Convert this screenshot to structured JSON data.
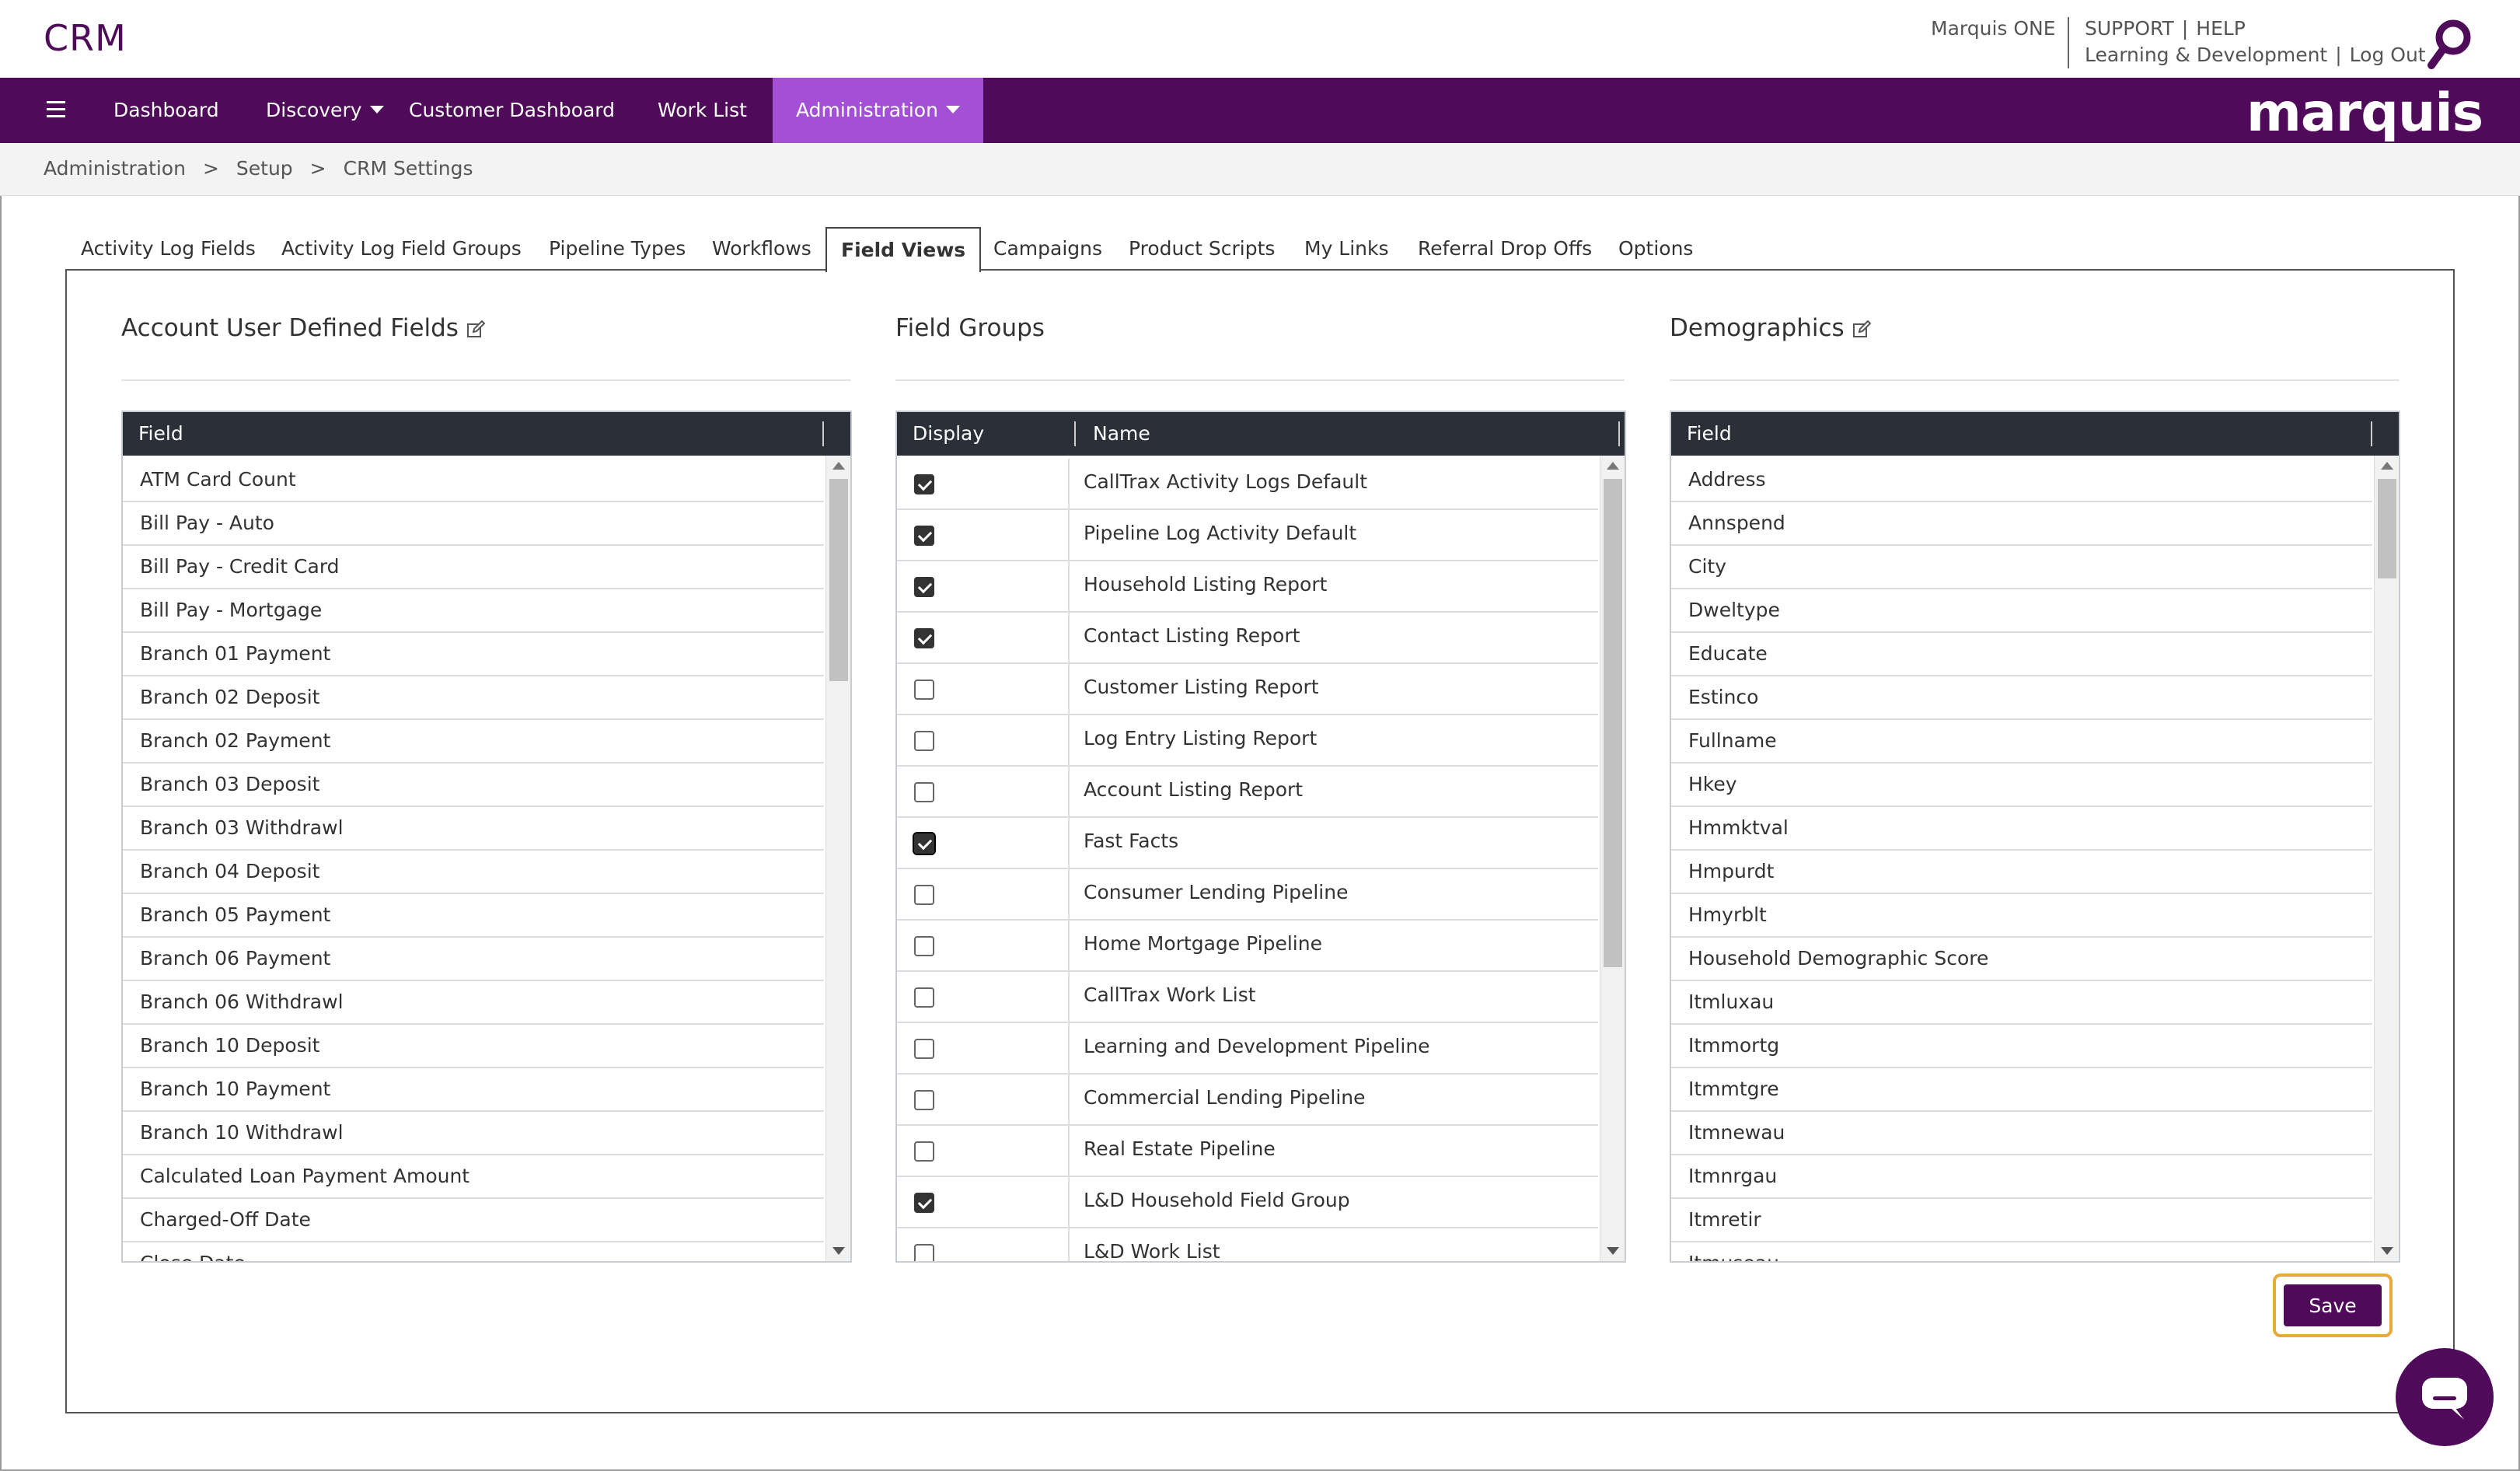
{
  "header": {
    "app_title": "CRM",
    "marquis_one": "Marquis ONE",
    "support": "SUPPORT",
    "help": "HELP",
    "learning": "Learning & Development",
    "logout": "Log Out",
    "search_icon": "search-icon"
  },
  "nav": {
    "menu_icon": "hamburger-icon",
    "items": [
      {
        "label": "Dashboard"
      },
      {
        "label": "Discovery"
      },
      {
        "label": "Customer Dashboard"
      },
      {
        "label": "Work List"
      },
      {
        "label": "Administration"
      }
    ],
    "brand": "marquis",
    "active_color": "#a34fd6",
    "bar_color": "#4f0a5a"
  },
  "breadcrumb": {
    "items": [
      "Administration",
      "Setup",
      "CRM Settings"
    ],
    "separator": ">"
  },
  "tabs": [
    {
      "label": "Activity Log Fields"
    },
    {
      "label": "Activity Log Field Groups"
    },
    {
      "label": "Pipeline Types"
    },
    {
      "label": "Workflows"
    },
    {
      "label": "Field Views",
      "active": true
    },
    {
      "label": "Campaigns"
    },
    {
      "label": "Product Scripts"
    },
    {
      "label": "My Links"
    },
    {
      "label": "Referral Drop Offs"
    },
    {
      "label": "Options"
    }
  ],
  "account_fields": {
    "title": "Account User Defined Fields",
    "column": "Field",
    "rows": [
      "ATM Card Count",
      "Bill Pay - Auto",
      "Bill Pay - Credit Card",
      "Bill Pay - Mortgage",
      "Branch 01 Payment",
      "Branch 02 Deposit",
      "Branch 02 Payment",
      "Branch 03 Deposit",
      "Branch 03 Withdrawl",
      "Branch 04 Deposit",
      "Branch 05 Payment",
      "Branch 06 Payment",
      "Branch 06 Withdrawl",
      "Branch 10 Deposit",
      "Branch 10 Payment",
      "Branch 10 Withdrawl",
      "Calculated Loan Payment Amount",
      "Charged-Off Date",
      "Close Date"
    ]
  },
  "field_groups": {
    "title": "Field Groups",
    "columns": {
      "display": "Display",
      "name": "Name"
    },
    "rows": [
      {
        "name": "CallTrax Activity Logs Default",
        "checked": true
      },
      {
        "name": "Pipeline Log Activity Default",
        "checked": true
      },
      {
        "name": "Household Listing Report",
        "checked": true
      },
      {
        "name": "Contact Listing Report",
        "checked": true
      },
      {
        "name": "Customer Listing Report",
        "checked": false
      },
      {
        "name": "Log Entry Listing Report",
        "checked": false
      },
      {
        "name": "Account Listing Report",
        "checked": false
      },
      {
        "name": "Fast Facts",
        "checked": true,
        "focused": true
      },
      {
        "name": "Consumer Lending Pipeline",
        "checked": false
      },
      {
        "name": "Home Mortgage Pipeline",
        "checked": false
      },
      {
        "name": "CallTrax Work List",
        "checked": false
      },
      {
        "name": "Learning and Development Pipeline",
        "checked": false
      },
      {
        "name": "Commercial Lending Pipeline",
        "checked": false
      },
      {
        "name": "Real Estate Pipeline",
        "checked": false
      },
      {
        "name": "L&D Household Field Group",
        "checked": true
      },
      {
        "name": "L&D Work List",
        "checked": false
      }
    ]
  },
  "demographics": {
    "title": "Demographics",
    "column": "Field",
    "rows": [
      "Address",
      "Annspend",
      "City",
      "Dweltype",
      "Educate",
      "Estinco",
      "Fullname",
      "Hkey",
      "Hmmktval",
      "Hmpurdt",
      "Hmyrblt",
      "Household Demographic Score",
      "Itmluxau",
      "Itmmortg",
      "Itmmtgre",
      "Itmnewau",
      "Itmnrgau",
      "Itmretir",
      "Itmuseau"
    ]
  },
  "actions": {
    "save": "Save",
    "chat_icon": "chat-icon"
  }
}
